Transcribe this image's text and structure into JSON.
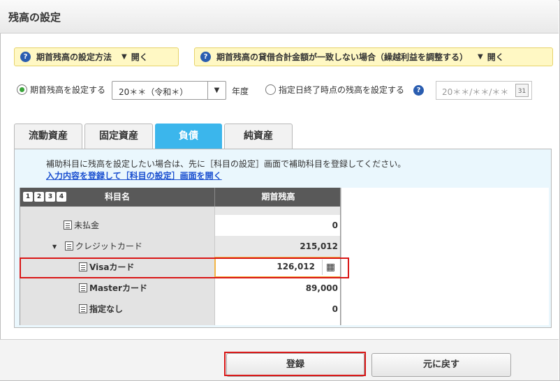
{
  "window": {
    "title": "残高の設定"
  },
  "help_boxes": [
    {
      "text": "期首残高の設定方法",
      "toggle": "開く"
    },
    {
      "text": "期首残高の貸借合計金額が一致しない場合（繰越利益を調整する）",
      "toggle": "開く"
    }
  ],
  "options": {
    "opening_balance_label": "期首残高を設定する",
    "year_select": "20＊＊（令和＊）",
    "year_unit": "年度",
    "date_balance_label": "指定日終了時点の残高を設定する",
    "date_placeholder": "20＊＊/＊＊/＊＊",
    "calendar_icon_text": "31"
  },
  "tabs": [
    {
      "label": "流動資産",
      "active": false
    },
    {
      "label": "固定資産",
      "active": false
    },
    {
      "label": "負債",
      "active": true
    },
    {
      "label": "純資産",
      "active": false
    }
  ],
  "notice": {
    "text": "補助科目に残高を設定したい場合は、先に［科目の設定］画面で補助科目を登録してください。",
    "link": "入力内容を登録して［科目の設定］画面を開く"
  },
  "grid": {
    "levels": [
      "1",
      "2",
      "3",
      "4"
    ],
    "col_account": "科目名",
    "col_balance": "期首残高",
    "rows": [
      {
        "name": "未払金",
        "amount": "0"
      },
      {
        "name": "クレジットカード",
        "amount": "215,012"
      },
      {
        "name": "Visaカード",
        "amount": "126,012"
      },
      {
        "name": "Masterカード",
        "amount": "89,000"
      },
      {
        "name": "指定なし",
        "amount": "0"
      }
    ]
  },
  "buttons": {
    "register": "登録",
    "revert": "元に戻す"
  },
  "colors": {
    "active_tab": "#3bb6ec",
    "highlight_red": "#d91616",
    "help_bg": "#fff8c4"
  }
}
